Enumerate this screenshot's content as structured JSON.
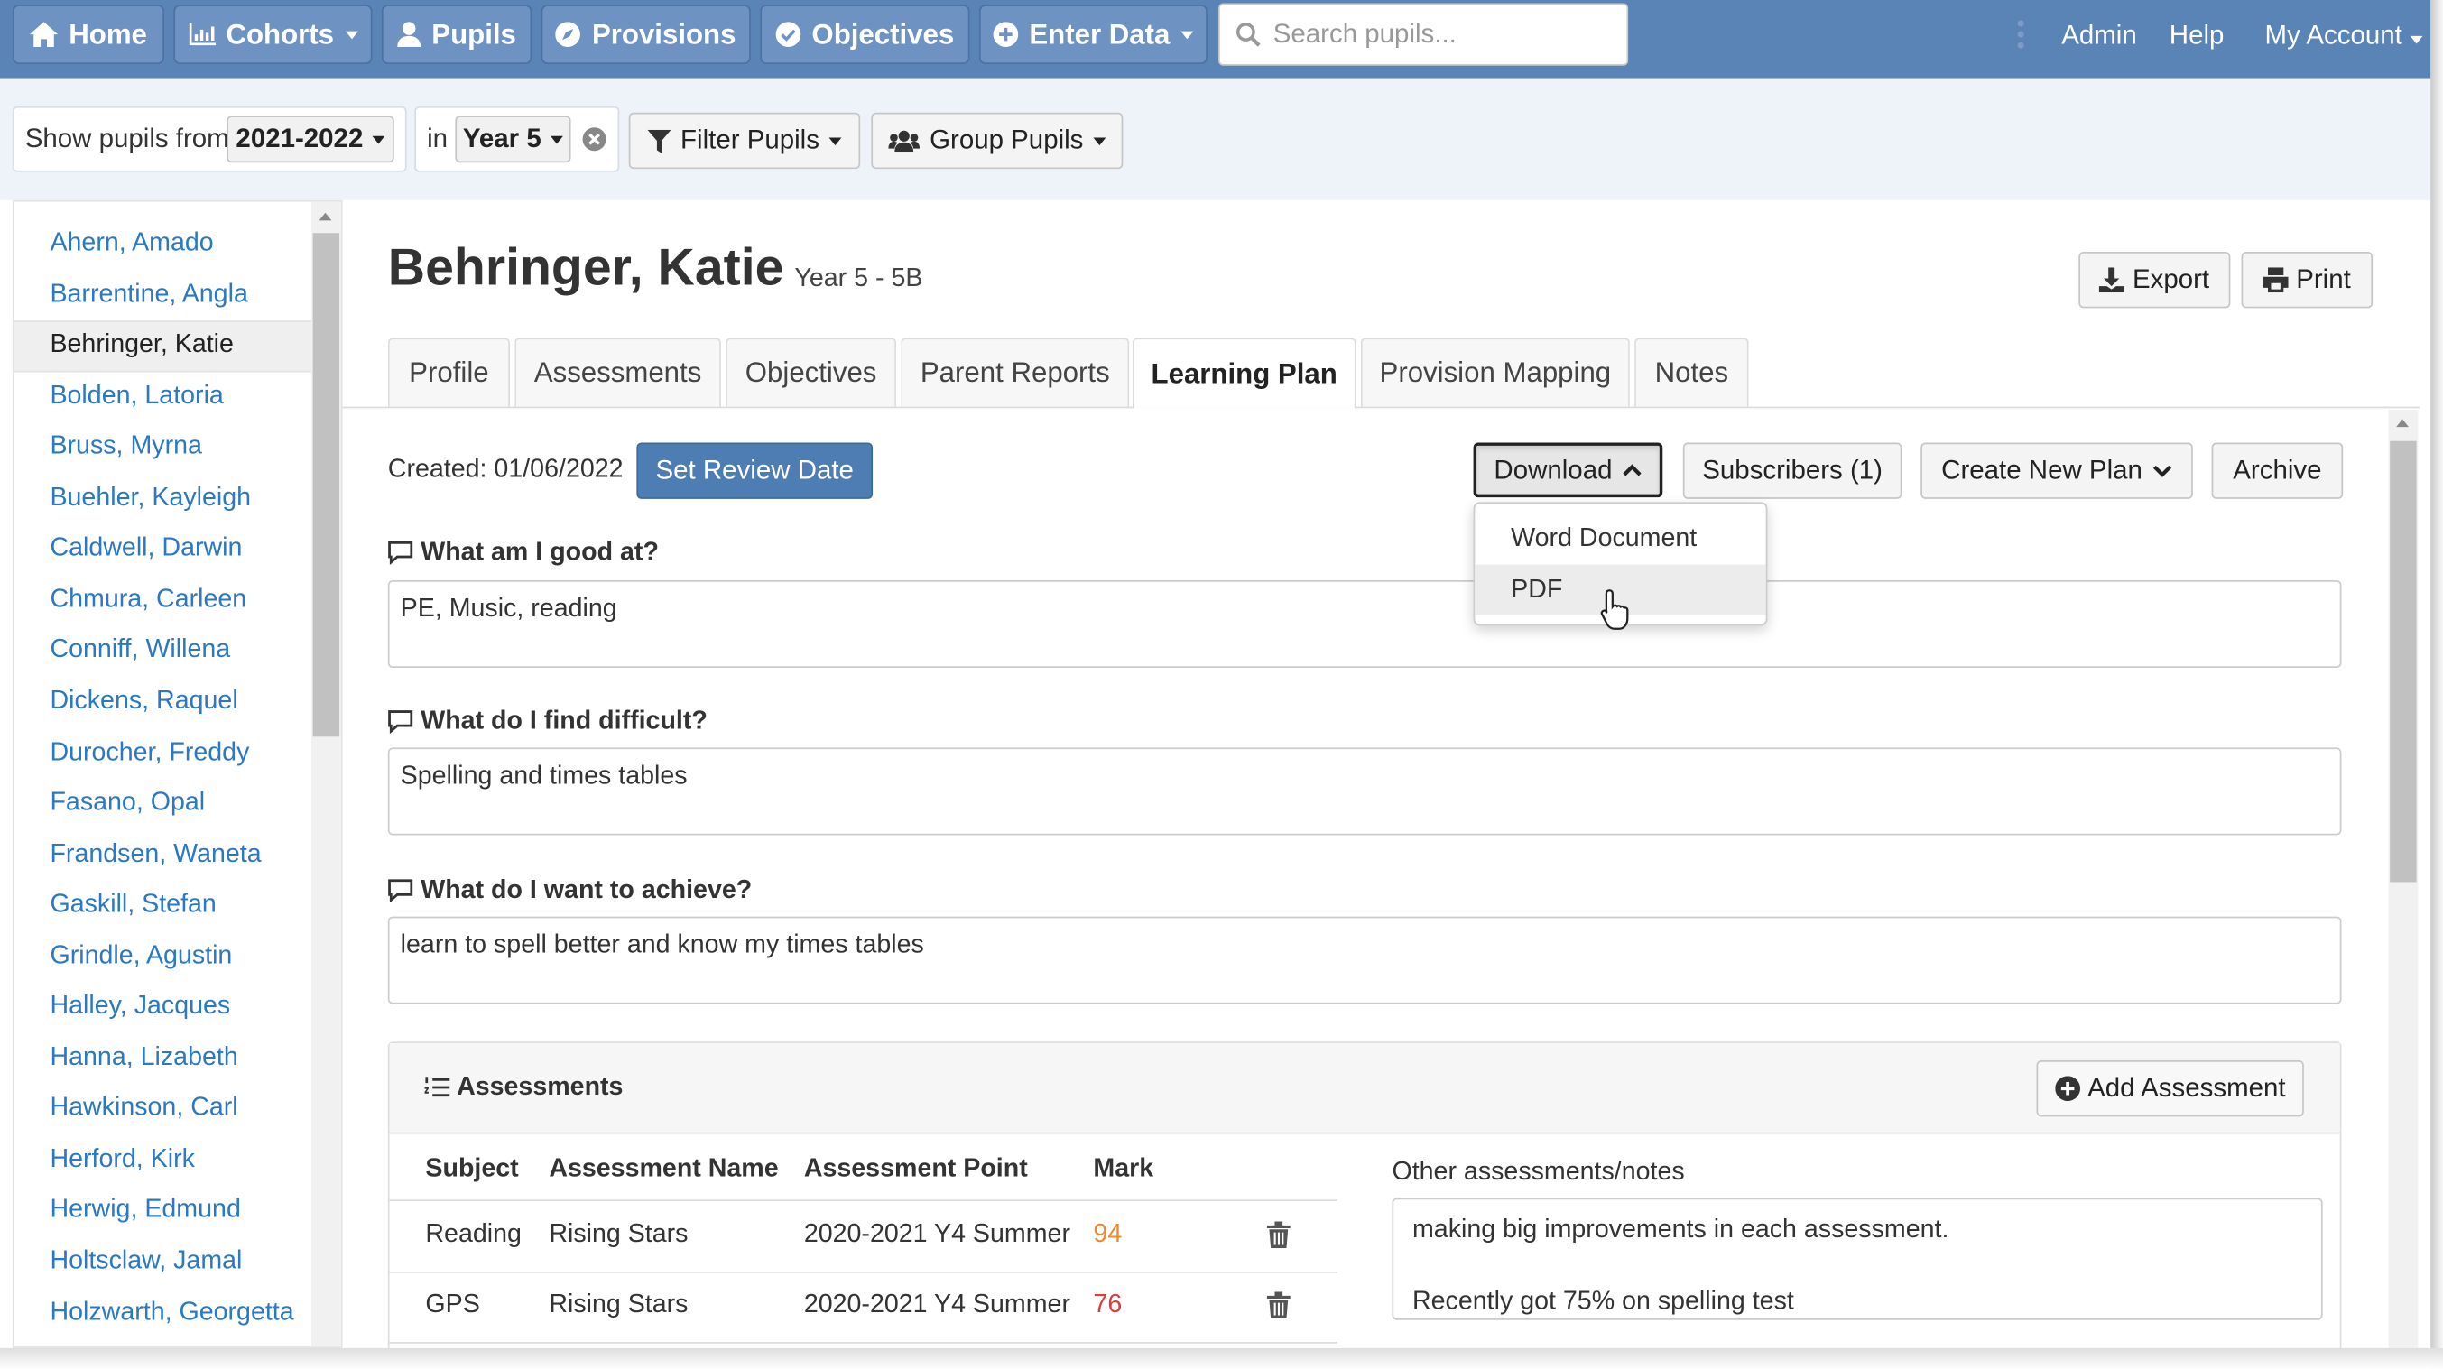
{
  "nav": {
    "home": "Home",
    "cohorts": "Cohorts",
    "pupils": "Pupils",
    "provisions": "Provisions",
    "objectives": "Objectives",
    "enter_data": "Enter Data",
    "search_placeholder": "Search pupils...",
    "admin": "Admin",
    "help": "Help",
    "my_account": "My Account"
  },
  "filters": {
    "show_label": "Show pupils from",
    "year_range": "2021-2022",
    "in_label": "in",
    "year_group": "Year 5",
    "filter_label": "Filter Pupils",
    "group_label": "Group Pupils"
  },
  "sidebar": {
    "pupils": [
      "Ahern, Amado",
      "Barrentine, Angla",
      "Behringer, Katie",
      "Bolden, Latoria",
      "Bruss, Myrna",
      "Buehler, Kayleigh",
      "Caldwell, Darwin",
      "Chmura, Carleen",
      "Conniff, Willena",
      "Dickens, Raquel",
      "Durocher, Freddy",
      "Fasano, Opal",
      "Frandsen, Waneta",
      "Gaskill, Stefan",
      "Grindle, Agustin",
      "Halley, Jacques",
      "Hanna, Lizabeth",
      "Hawkinson, Carl",
      "Herford, Kirk",
      "Herwig, Edmund",
      "Holtsclaw, Jamal",
      "Holzwarth, Georgetta"
    ],
    "selected": "Behringer, Katie"
  },
  "pupil": {
    "name": "Behringer, Katie",
    "class": "Year 5 - 5B",
    "export_label": "Export",
    "print_label": "Print"
  },
  "tabs": [
    "Profile",
    "Assessments",
    "Objectives",
    "Parent Reports",
    "Learning Plan",
    "Provision Mapping",
    "Notes"
  ],
  "active_tab": "Learning Plan",
  "plan": {
    "created": "Created: 01/06/2022",
    "set_review": "Set Review Date",
    "download": "Download",
    "subscribers": "Subscribers (1)",
    "create_new": "Create New Plan",
    "archive": "Archive",
    "download_menu": [
      "Word Document",
      "PDF"
    ],
    "questions": [
      {
        "q": "What am I good at?",
        "a": "PE, Music, reading"
      },
      {
        "q": "What do I find difficult?",
        "a": "Spelling and times tables"
      },
      {
        "q": "What do I want to achieve?",
        "a": "learn to spell better and know my times tables"
      }
    ]
  },
  "assessments": {
    "title": "Assessments",
    "add_label": "Add Assessment",
    "columns": [
      "Subject",
      "Assessment Name",
      "Assessment Point",
      "Mark"
    ],
    "rows": [
      {
        "subject": "Reading",
        "name": "Rising Stars",
        "point": "2020-2021 Y4 Summer",
        "mark": "94",
        "mark_color": "#f0892a"
      },
      {
        "subject": "GPS",
        "name": "Rising Stars",
        "point": "2020-2021 Y4 Summer",
        "mark": "76",
        "mark_color": "#e23b3b"
      }
    ],
    "notes_label": "Other assessments/notes",
    "notes_line1": "making big improvements in each assessment.",
    "notes_line2": "Recently got 75% on spelling test"
  },
  "colors": {
    "navbar": "#5b84b6",
    "link": "#2b78c3",
    "primary": "#4e7db3"
  }
}
